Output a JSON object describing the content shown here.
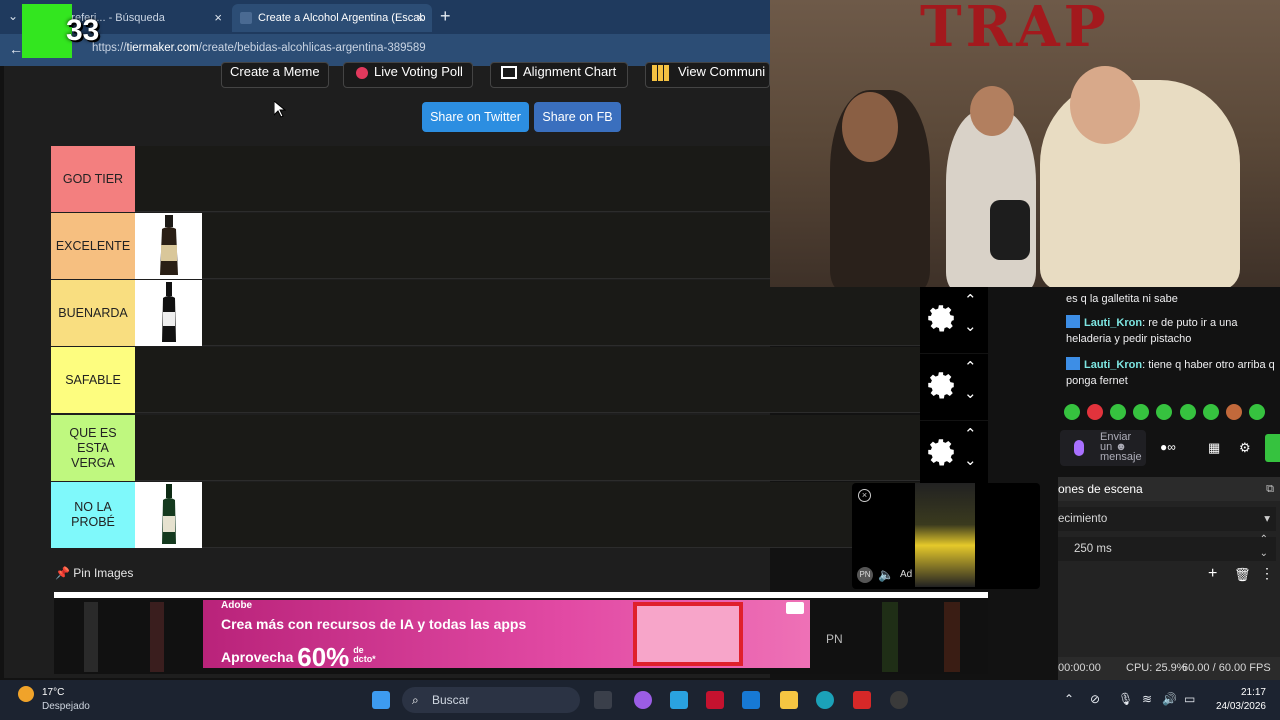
{
  "browser": {
    "tabs": [
      {
        "title": "e preferi... - Búsqueda"
      },
      {
        "title": "Create a Alcohol Argentina (Escab"
      }
    ],
    "url_prefix": "https://",
    "url_domain": "tiermaker.com",
    "url_path": "/create/bebidas-alcohlicas-argentina-389589",
    "new_tab_icon": "+",
    "close_icon": "×",
    "back_icon": "←"
  },
  "overlay_badge": "33",
  "page": {
    "nav_buttons": [
      {
        "label": "Create a Meme"
      },
      {
        "label": "Live Voting Poll"
      },
      {
        "label": "Alignment Chart"
      },
      {
        "label": "View Communi"
      }
    ],
    "share_buttons": [
      {
        "label": "Share on Twitter"
      },
      {
        "label": "Share on FB"
      }
    ],
    "tiers": [
      {
        "label": "GOD TIER",
        "color": "#f37f7f",
        "items": 0
      },
      {
        "label": "EXCELENTE",
        "color": "#f6bf80",
        "items": 1
      },
      {
        "label": "BUENARDA",
        "color": "#f9de80",
        "items": 1
      },
      {
        "label": "SAFABLE",
        "color": "#fdfd7f",
        "items": 0
      },
      {
        "label": "QUE ES ESTA VERGA",
        "color": "#bff87f",
        "items": 0
      },
      {
        "label": "NO LA PROBÉ",
        "color": "#7ff9fb",
        "items": 1
      }
    ],
    "pin_label": "Pin Images",
    "ad": {
      "brand": "Adobe",
      "line1": "Crea más con recursos de IA y todas las apps",
      "line2_prefix": "Aprovecha",
      "line2_pct": "60%",
      "line2_suffix_a": "de",
      "line2_suffix_b": "dcto*"
    },
    "video_ad": {
      "label": "Ad",
      "badge": "PN"
    },
    "strip_badge": "PN"
  },
  "stream": {
    "wall_text": "TRAP",
    "chat": [
      {
        "user": "",
        "text": "es q la galletita ni sabe"
      },
      {
        "user": "Lauti_Kron",
        "text": "re de puto ir a una heladeria y pedir pistacho"
      },
      {
        "user": "Lauti_Kron",
        "text": "tiene q haber otro arriba q ponga fernet"
      }
    ],
    "chat_input_placeholder": "Enviar un ☻ mensaje",
    "obs": {
      "header": "ones de escena",
      "transition": "ecimiento",
      "duration": "250 ms",
      "time": "00:00:00",
      "cpu": "CPU: 25.9%",
      "fps": "60.00 / 60.00 FPS"
    }
  },
  "taskbar": {
    "temp": "17°C",
    "condition": "Despejado",
    "search_placeholder": "Buscar",
    "time": "21:17",
    "date": "24/03/2026"
  }
}
